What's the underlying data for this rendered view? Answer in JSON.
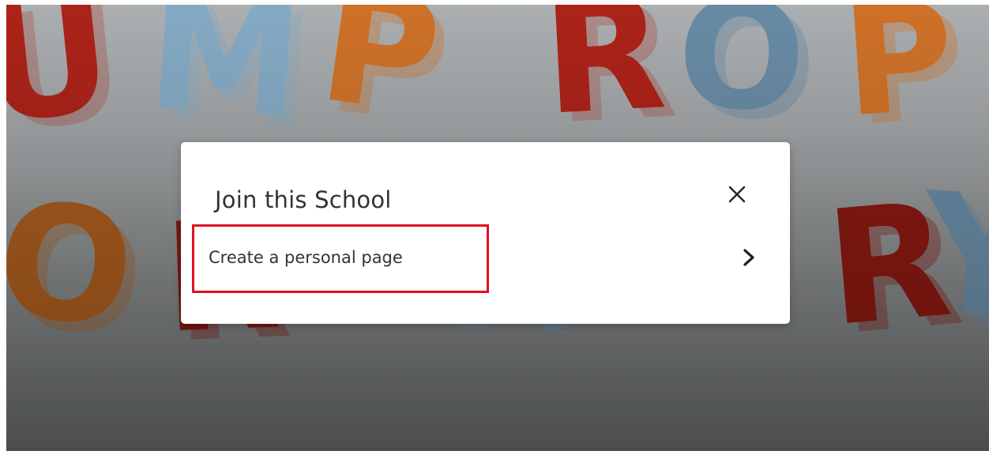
{
  "background": {
    "letters_row1": [
      "U",
      "M",
      "P",
      "R",
      "O",
      "P"
    ],
    "letters_row2": [
      "O",
      "R",
      "A",
      "R",
      "Y"
    ]
  },
  "modal": {
    "title": "Join this School",
    "close_icon": "close-icon",
    "option": {
      "label": "Create a personal page",
      "icon": "chevron-right-icon"
    }
  },
  "annotation": {
    "highlight_color": "#e0121f"
  }
}
